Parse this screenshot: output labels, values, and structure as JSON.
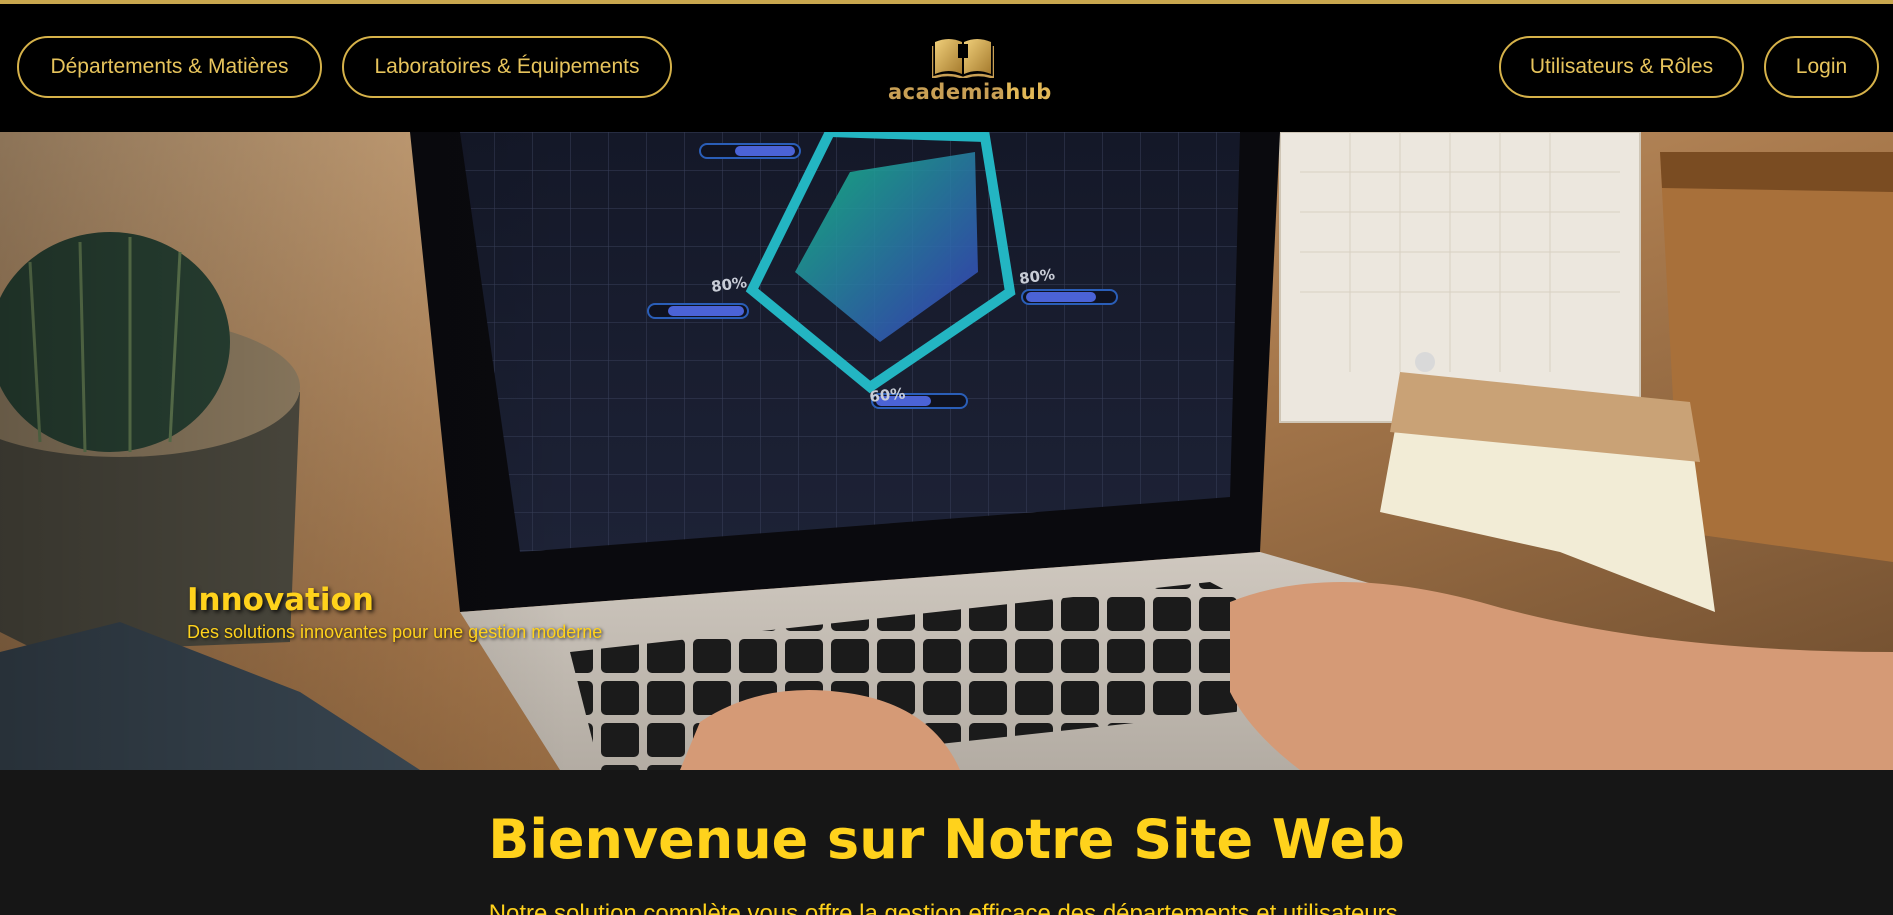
{
  "nav": {
    "departments": "Départements & Matières",
    "labs": "Laboratoires & Équipements",
    "users": "Utilisateurs & Rôles",
    "login": "Login"
  },
  "logo": {
    "part1": "academia",
    "part2": "hub",
    "icon": "open-book-icon"
  },
  "hero": {
    "title": "Innovation",
    "subtitle": "Des solutions innovantes pour une gestion moderne",
    "screen_labels": [
      "80%",
      "80%",
      "60%"
    ]
  },
  "welcome": {
    "title": "Bienvenue sur Notre Site Web",
    "text": "Notre solution complète vous offre la gestion efficace des départements et utilisateurs."
  },
  "colors": {
    "accent": "#ffd21c",
    "gold": "#d6b24a",
    "header_bg": "#000000",
    "section_bg": "#161616"
  }
}
